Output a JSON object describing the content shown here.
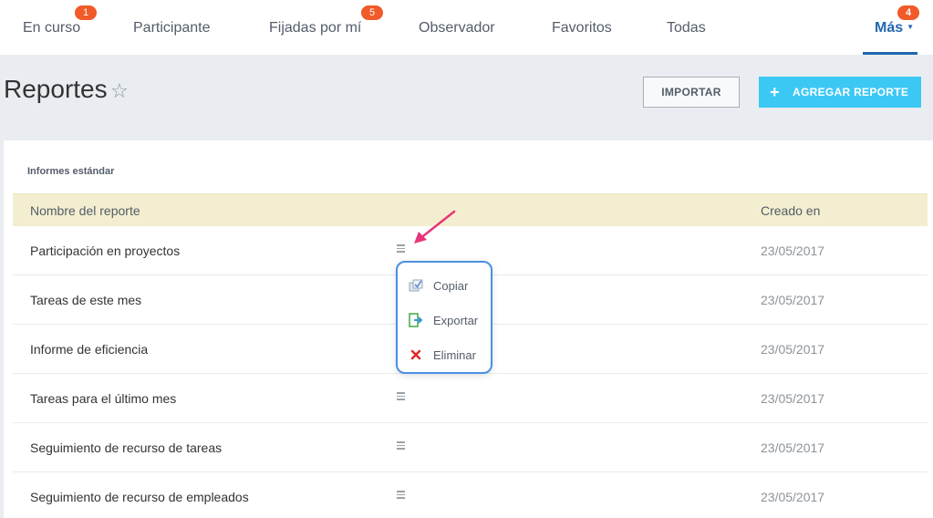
{
  "nav": {
    "tabs": [
      {
        "label": "En curso",
        "badge": "1"
      },
      {
        "label": "Participante",
        "badge": ""
      },
      {
        "label": "Fijadas por mí",
        "badge": "5"
      },
      {
        "label": "Observador",
        "badge": ""
      },
      {
        "label": "Favoritos",
        "badge": ""
      },
      {
        "label": "Todas",
        "badge": ""
      }
    ],
    "more": {
      "label": "Más",
      "badge": "4"
    }
  },
  "header": {
    "title": "Reportes",
    "import_label": "IMPORTAR",
    "add_label": "AGREGAR REPORTE"
  },
  "section": {
    "title": "Informes estándar"
  },
  "table": {
    "columns": [
      "Nombre del reporte",
      "Creado en"
    ],
    "rows": [
      {
        "name": "Participación en proyectos",
        "date": "23/05/2017"
      },
      {
        "name": "Tareas de este mes",
        "date": "23/05/2017"
      },
      {
        "name": "Informe de eficiencia",
        "date": "23/05/2017"
      },
      {
        "name": "Tareas para el último mes",
        "date": "23/05/2017"
      },
      {
        "name": "Seguimiento de recurso de tareas",
        "date": "23/05/2017"
      },
      {
        "name": "Seguimiento de recurso de empleados",
        "date": "23/05/2017"
      }
    ]
  },
  "popup": {
    "items": [
      {
        "label": "Copiar",
        "icon": "copy-icon"
      },
      {
        "label": "Exportar",
        "icon": "export-icon"
      },
      {
        "label": "Eliminar",
        "icon": "delete-icon"
      }
    ]
  },
  "colors": {
    "accent": "#2067b0",
    "badge": "#f15a29",
    "add_button": "#3bc8f5",
    "table_header": "#f3eecf",
    "popup_border": "#4a90e2",
    "arrow": "#e8347a"
  }
}
